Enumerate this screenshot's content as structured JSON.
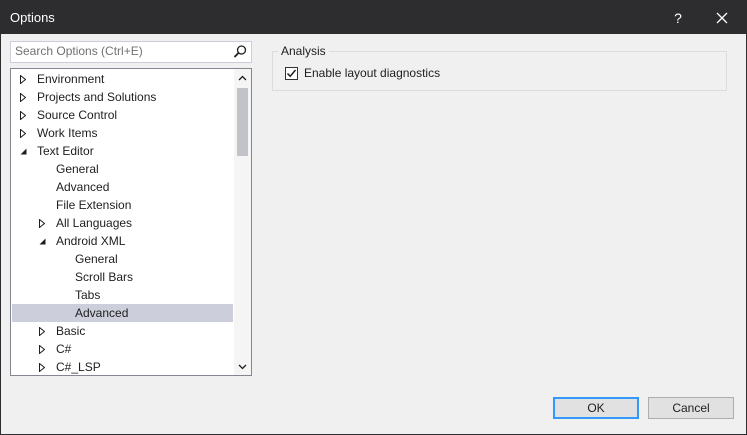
{
  "window": {
    "title": "Options",
    "help_label": "?",
    "close_label": "✕"
  },
  "search": {
    "placeholder": "Search Options (Ctrl+E)",
    "value": ""
  },
  "tree": {
    "items": [
      {
        "label": "Environment",
        "state": "collapsed"
      },
      {
        "label": "Projects and Solutions",
        "state": "collapsed"
      },
      {
        "label": "Source Control",
        "state": "collapsed"
      },
      {
        "label": "Work Items",
        "state": "collapsed"
      },
      {
        "label": "Text Editor",
        "state": "expanded"
      },
      {
        "label": "General",
        "state": "leaf"
      },
      {
        "label": "Advanced",
        "state": "leaf"
      },
      {
        "label": "File Extension",
        "state": "leaf"
      },
      {
        "label": "All Languages",
        "state": "collapsed"
      },
      {
        "label": "Android XML",
        "state": "expanded"
      },
      {
        "label": "General",
        "state": "leaf"
      },
      {
        "label": "Scroll Bars",
        "state": "leaf"
      },
      {
        "label": "Tabs",
        "state": "leaf"
      },
      {
        "label": "Advanced",
        "state": "leaf",
        "selected": true
      },
      {
        "label": "Basic",
        "state": "collapsed"
      },
      {
        "label": "C#",
        "state": "collapsed"
      },
      {
        "label": "C#_LSP",
        "state": "collapsed"
      }
    ]
  },
  "analysis": {
    "group_label": "Analysis",
    "checkbox_label": "Enable layout diagnostics",
    "checked": true
  },
  "buttons": {
    "ok_label": "OK",
    "cancel_label": "Cancel"
  },
  "colors": {
    "titlebar": "#2d2d30",
    "selection": "#cccedb",
    "accent": "#3399ff"
  }
}
